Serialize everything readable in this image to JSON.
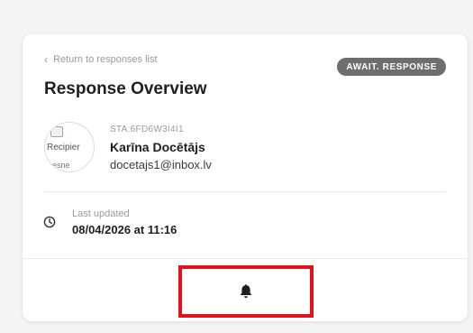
{
  "card": {
    "back_link": "Return to responses list",
    "status_badge": "AWAIT. RESPONSE",
    "title": "Response Overview",
    "recipient": {
      "avatar_alt_line1": "Recipier",
      "avatar_alt_line2": "esne",
      "reference": "STA:6FD6W3I4I1",
      "name": "Karīna Docētājs",
      "email": "docetajs1@inbox.lv"
    },
    "last_updated": {
      "label": "Last updated",
      "value": "08/04/2026 at 11:16"
    }
  },
  "icons": {
    "back": "chevron-left-icon",
    "clock": "clock-icon",
    "notify": "bell-icon"
  },
  "colors": {
    "badge_bg": "#6e6e6e",
    "highlight": "#e2121b"
  }
}
